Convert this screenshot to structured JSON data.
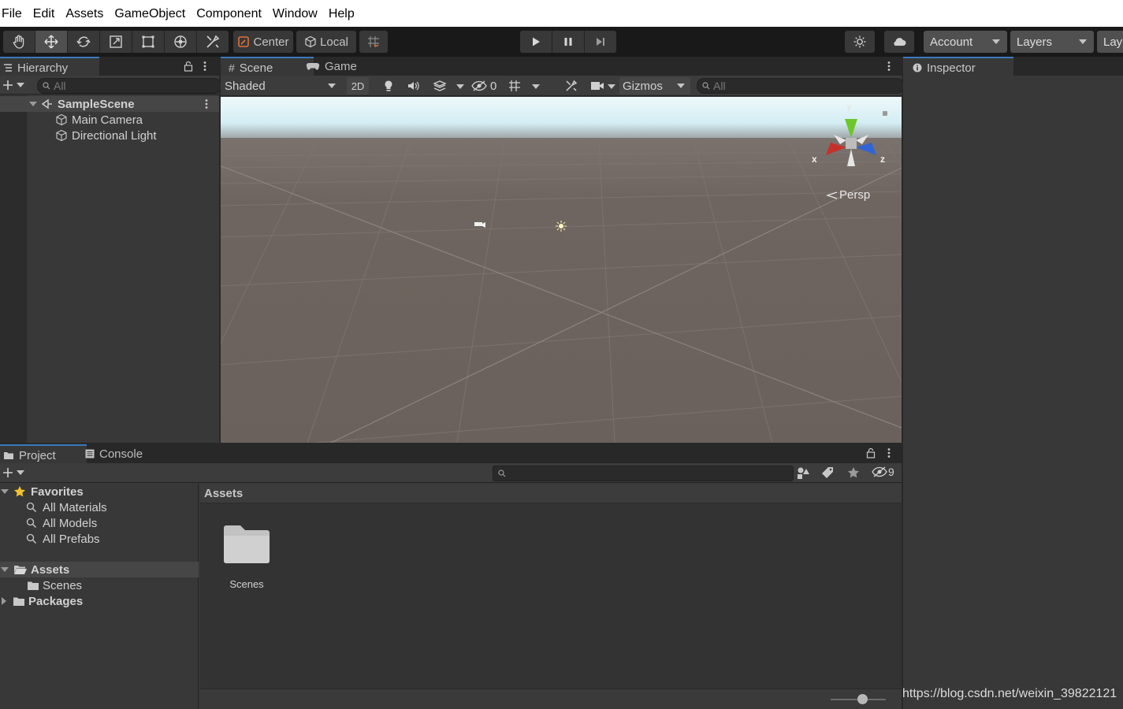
{
  "menubar": {
    "items": [
      "File",
      "Edit",
      "Assets",
      "GameObject",
      "Component",
      "Window",
      "Help"
    ]
  },
  "toolbar": {
    "tools": [
      "hand-icon",
      "move-icon",
      "rotate-icon",
      "scale-icon",
      "rect-tool-icon",
      "transform-icon",
      "custom-tool-icon"
    ],
    "pivot_label": "Center",
    "space_label": "Local",
    "account_label": "Account",
    "layers_label": "Layers",
    "layout_label": "Lay"
  },
  "hierarchy": {
    "tab_label": "Hierarchy",
    "search_placeholder": "All",
    "scene_name": "SampleScene",
    "objects": [
      "Main Camera",
      "Directional Light"
    ]
  },
  "scene_view": {
    "tabs": [
      "Scene",
      "Game"
    ],
    "draw_mode": "Shaded",
    "mode_2d": "2D",
    "hidden_count": "0",
    "gizmos_label": "Gizmos",
    "search_placeholder": "All",
    "gizmo_axes": {
      "x": "x",
      "y": "y",
      "z": "z"
    },
    "projection_label": "Persp"
  },
  "inspector": {
    "tab_label": "Inspector"
  },
  "project": {
    "tabs": [
      "Project",
      "Console"
    ],
    "favorites_label": "Favorites",
    "favorites": [
      "All Materials",
      "All Models",
      "All Prefabs"
    ],
    "assets_label": "Assets",
    "assets_children": [
      "Scenes"
    ],
    "packages_label": "Packages",
    "breadcrumb": "Assets",
    "hidden_packages_count": "9",
    "items": [
      {
        "name": "Scenes",
        "type": "folder"
      }
    ]
  },
  "watermark": "https://blog.csdn.net/weixin_39822121",
  "colors": {
    "accent": "#3a79bb",
    "sky": "#dff4f8",
    "ground": "#6e6560",
    "x_axis": "#c8302a",
    "y_axis": "#6cc72c",
    "z_axis": "#3264d6"
  }
}
